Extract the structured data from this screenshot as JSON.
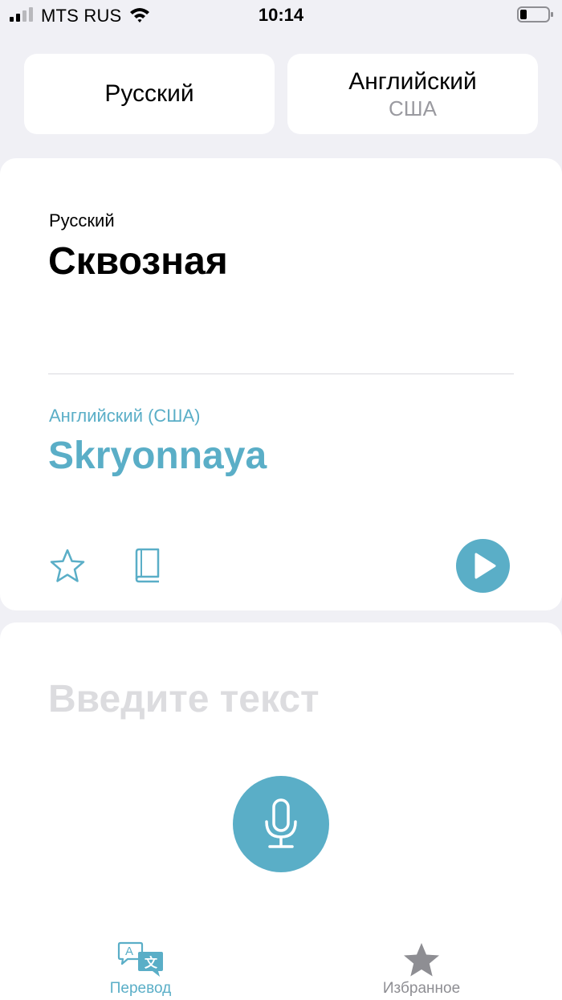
{
  "status_bar": {
    "carrier": "MTS RUS",
    "time": "10:14"
  },
  "languages": {
    "source": {
      "name": "Русский"
    },
    "target": {
      "name": "Английский",
      "region": "США"
    }
  },
  "result": {
    "source_label": "Русский",
    "source_text": "Сквозная",
    "target_label": "Английский (США)",
    "target_text": "Skryonnaya"
  },
  "input": {
    "placeholder": "Введите текст",
    "value": ""
  },
  "tabs": [
    {
      "label": "Перевод",
      "icon": "translate-icon",
      "active": true
    },
    {
      "label": "Избранное",
      "icon": "star-filled-icon",
      "active": false
    }
  ],
  "colors": {
    "accent": "#5aaec7",
    "background": "#f0f0f5",
    "inactive_tab": "#8e8e93",
    "placeholder": "#dcdcdf"
  },
  "icons": {
    "favorite": "star-outline-icon",
    "dictionary": "book-icon",
    "play": "play-icon",
    "mic": "microphone-icon"
  }
}
